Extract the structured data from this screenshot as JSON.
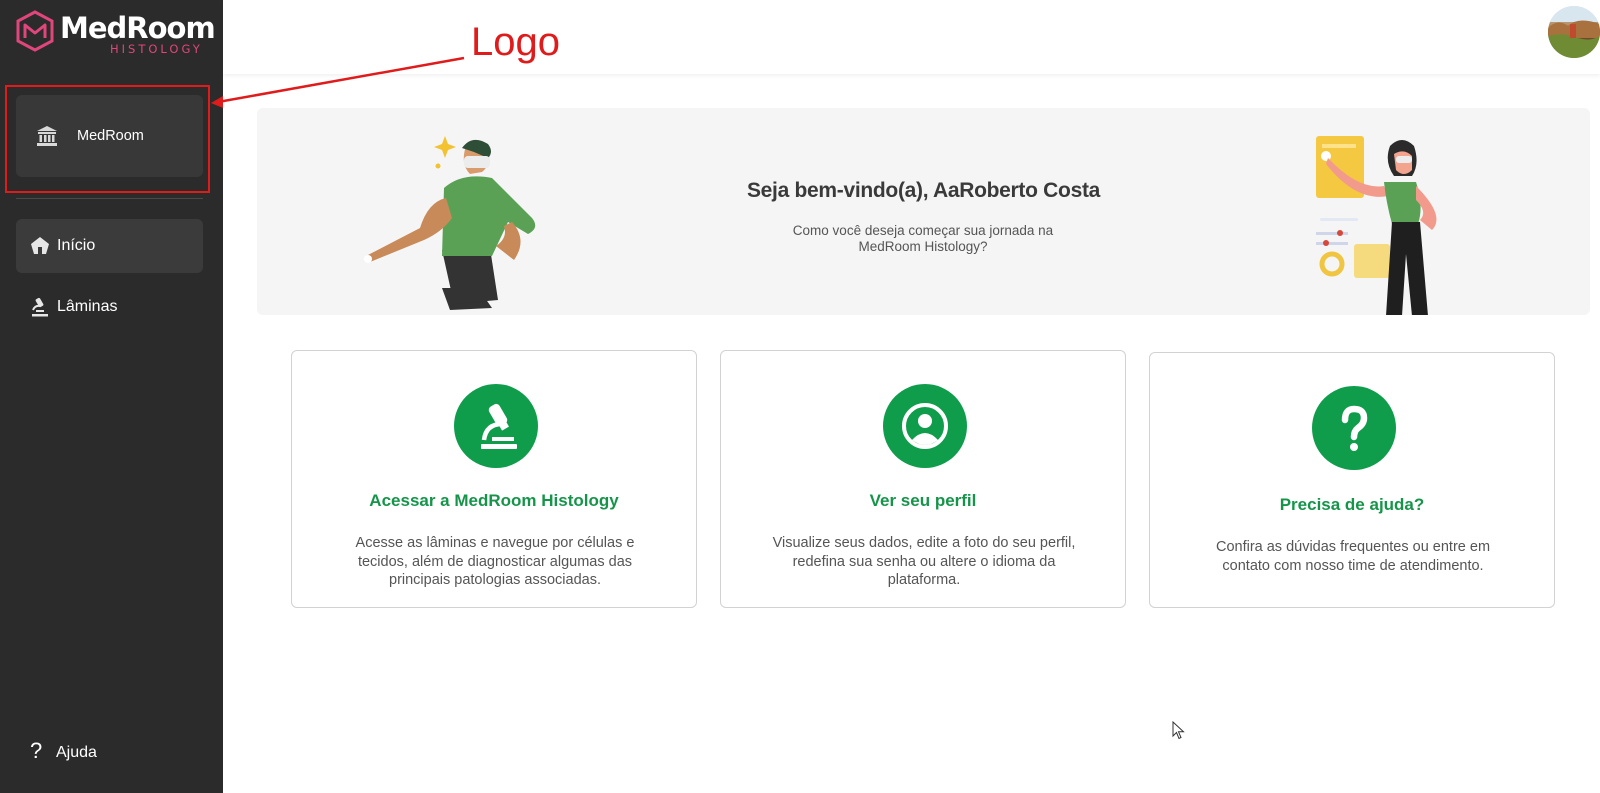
{
  "sidebar": {
    "logo": {
      "name": "MedRoom",
      "subtitle": "HISTOLOGY"
    },
    "institution": {
      "label": "MedRoom",
      "icon": "institution-icon"
    },
    "nav": [
      {
        "label": "Início",
        "icon": "home-icon",
        "active": true
      },
      {
        "label": "Lâminas",
        "icon": "microscope-icon",
        "active": false
      }
    ],
    "help": {
      "label": "Ajuda",
      "icon": "question-icon"
    }
  },
  "header": {
    "avatar": "user-avatar"
  },
  "annotation": {
    "text": "Logo",
    "color": "#e01b1b"
  },
  "banner": {
    "title": "Seja bem-vindo(a), AaRoberto Costa",
    "subtitle": "Como você deseja começar sua jornada na MedRoom Histology?"
  },
  "cards": [
    {
      "icon": "microscope-icon",
      "title": "Acessar a MedRoom Histology",
      "description": "Acesse as lâminas e navegue por células e tecidos, além de diagnosticar algumas das principais patologias associadas."
    },
    {
      "icon": "user-circle-icon",
      "title": "Ver seu perfil",
      "description": "Visualize seus dados, edite a foto do seu perfil, redefina sua senha ou altere o idioma da plataforma."
    },
    {
      "icon": "question-icon",
      "title": "Precisa de ajuda?",
      "description": "Confira as dúvidas frequentes ou entre em contato com nosso time de atendimento."
    }
  ],
  "colors": {
    "sidebar_bg": "#2b2b2b",
    "accent_green": "#0f9d4c",
    "brand_pink": "#e0457b",
    "annotation_red": "#e01b1b"
  }
}
